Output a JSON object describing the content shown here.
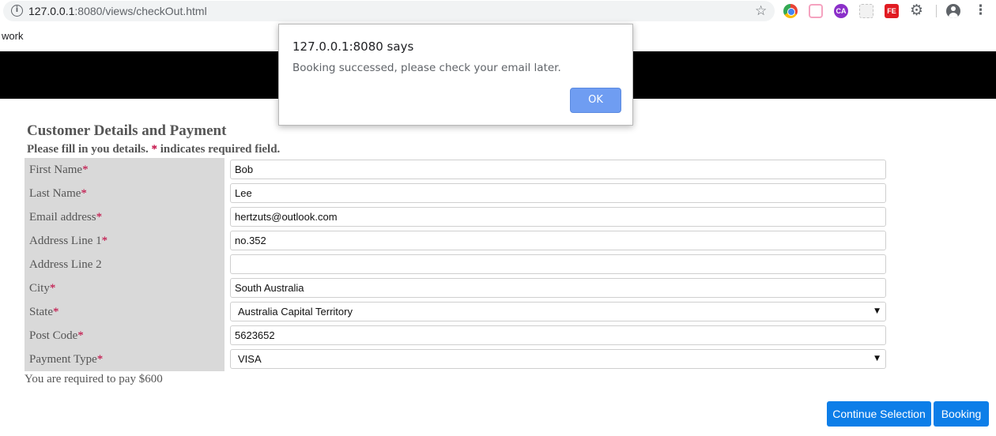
{
  "browser": {
    "url_host": "127.0.0.1",
    "url_rest": ":8080/views/checkOut.html",
    "bookmark": "work",
    "extensions": {
      "ca": "CA",
      "fe": "FE"
    }
  },
  "page": {
    "section_title": "Customer Details and Payment",
    "instructions_pre": "Please fill in you details. ",
    "instructions_star": "*",
    "instructions_post": " indicates required field.",
    "fields": [
      {
        "label": "First Name",
        "required": "*",
        "value": "Bob"
      },
      {
        "label": "Last Name",
        "required": "*",
        "value": "Lee"
      },
      {
        "label": "Email address",
        "required": "*",
        "value": "hertzuts@outlook.com"
      },
      {
        "label": "Address Line 1",
        "required": "*",
        "value": "no.352"
      },
      {
        "label": "Address Line 2",
        "required": "",
        "value": ""
      },
      {
        "label": "City",
        "required": "*",
        "value": "South Australia"
      },
      {
        "label": "State",
        "required": "*",
        "value": "Australia Capital Territory"
      },
      {
        "label": "Post Code",
        "required": "*",
        "value": "5623652"
      },
      {
        "label": "Payment Type",
        "required": "*",
        "value": "VISA"
      }
    ],
    "pay_note": "You are required to pay $600",
    "continue_label": "Continue Selection",
    "booking_label": "Booking"
  },
  "dialog": {
    "title": "127.0.0.1:8080 says",
    "message": "Booking successed, please check your email later.",
    "ok_label": "OK"
  },
  "icons": {
    "info": "info-icon",
    "star": "bookmark-star-icon",
    "gear": "gear-icon",
    "menu": "more-vert-icon"
  },
  "colors": {
    "accent_button": "#0d7ee8",
    "required_star": "#c0003c",
    "banner": "#000000",
    "label_bg": "#d9d9d9"
  }
}
